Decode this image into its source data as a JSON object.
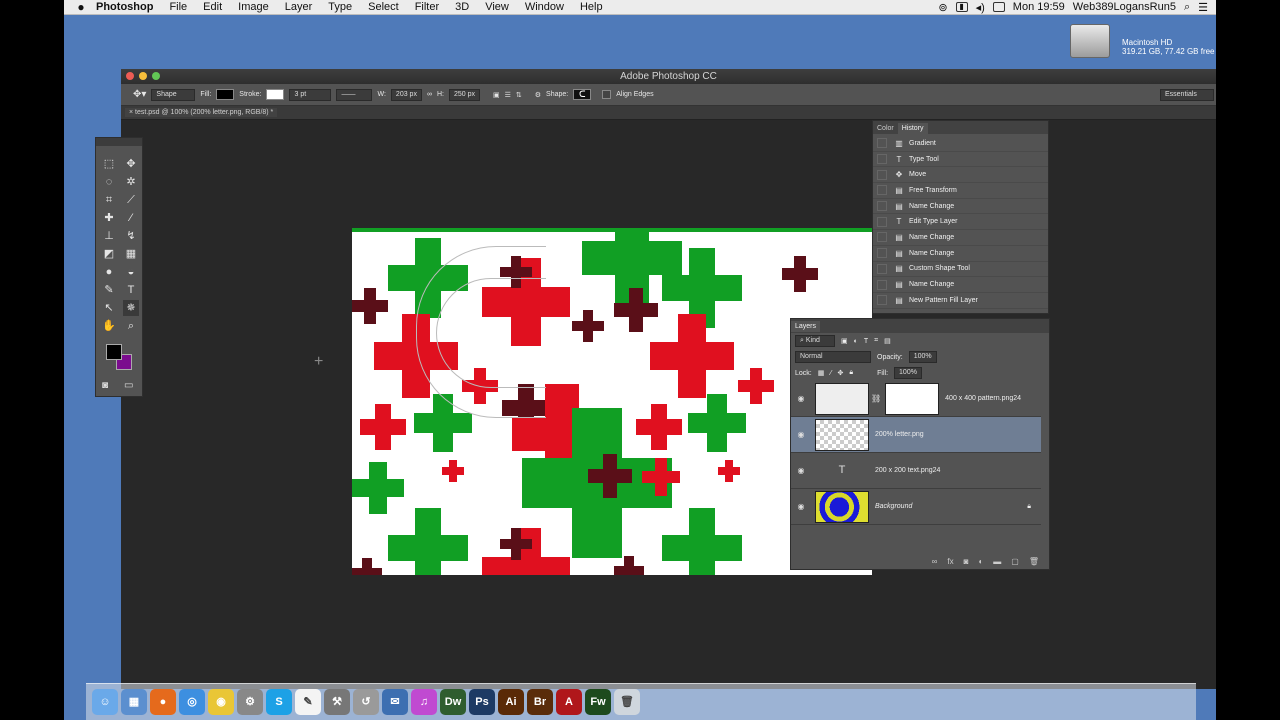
{
  "menubar": {
    "app": "Photoshop",
    "menus": [
      "File",
      "Edit",
      "Image",
      "Layer",
      "Type",
      "Select",
      "Filter",
      "3D",
      "View",
      "Window",
      "Help"
    ],
    "clock": "Mon 19:59",
    "user": "Web389LogansRun5"
  },
  "desktop": {
    "drive_name": "Macintosh HD",
    "drive_size": "319.21 GB, 77.42 GB free"
  },
  "window": {
    "title": "Adobe Photoshop CC",
    "doc_tab": "test.psd @ 100% (200% letter.png, RGB/8) *"
  },
  "options": {
    "mode": "Shape",
    "fill_label": "Fill:",
    "stroke_label": "Stroke:",
    "stroke_size": "3 pt",
    "w_label": "W:",
    "w_value": "203 px",
    "h_label": "H:",
    "h_value": "250 px",
    "shape_label": "Shape:",
    "align_edges": "Align Edges",
    "workspace": "Essentials"
  },
  "colors": {
    "foreground": "#000000",
    "background": "#7b0c8e"
  },
  "history": {
    "tabs": [
      "Color",
      "History"
    ],
    "active_tab": "History",
    "items": [
      {
        "icon": "gradient-icon",
        "label": "Gradient"
      },
      {
        "icon": "type-icon",
        "label": "Type Tool"
      },
      {
        "icon": "move-icon",
        "label": "Move"
      },
      {
        "icon": "step-icon",
        "label": "Free Transform"
      },
      {
        "icon": "step-icon",
        "label": "Name Change"
      },
      {
        "icon": "type-icon",
        "label": "Edit Type Layer"
      },
      {
        "icon": "step-icon",
        "label": "Name Change"
      },
      {
        "icon": "step-icon",
        "label": "Name Change"
      },
      {
        "icon": "step-icon",
        "label": "Custom Shape Tool"
      },
      {
        "icon": "step-icon",
        "label": "Name Change"
      },
      {
        "icon": "step-icon",
        "label": "New Pattern Fill Layer"
      }
    ]
  },
  "layers": {
    "tab": "Layers",
    "filter": "Kind",
    "blend_mode": "Normal",
    "opacity_label": "Opacity:",
    "opacity": "100%",
    "lock_label": "Lock:",
    "fill_label": "Fill:",
    "fill": "100%",
    "items": [
      {
        "name": "400 x 400 pattern.png24",
        "selected": false
      },
      {
        "name": "200% letter.png",
        "selected": true
      },
      {
        "name": "200 x 200 text.png24",
        "selected": false
      },
      {
        "name": "Background",
        "selected": false
      }
    ]
  },
  "dock": {
    "apps": [
      "Finder",
      "Preview",
      "Firefox",
      "Safari",
      "Chrome",
      "System",
      "Skype",
      "TextEdit",
      "Tools",
      "Migrate",
      "Mail",
      "iTunes",
      "Dw",
      "Ps",
      "Ai",
      "Br",
      "Acrobat",
      "Fw",
      "Trash"
    ]
  }
}
